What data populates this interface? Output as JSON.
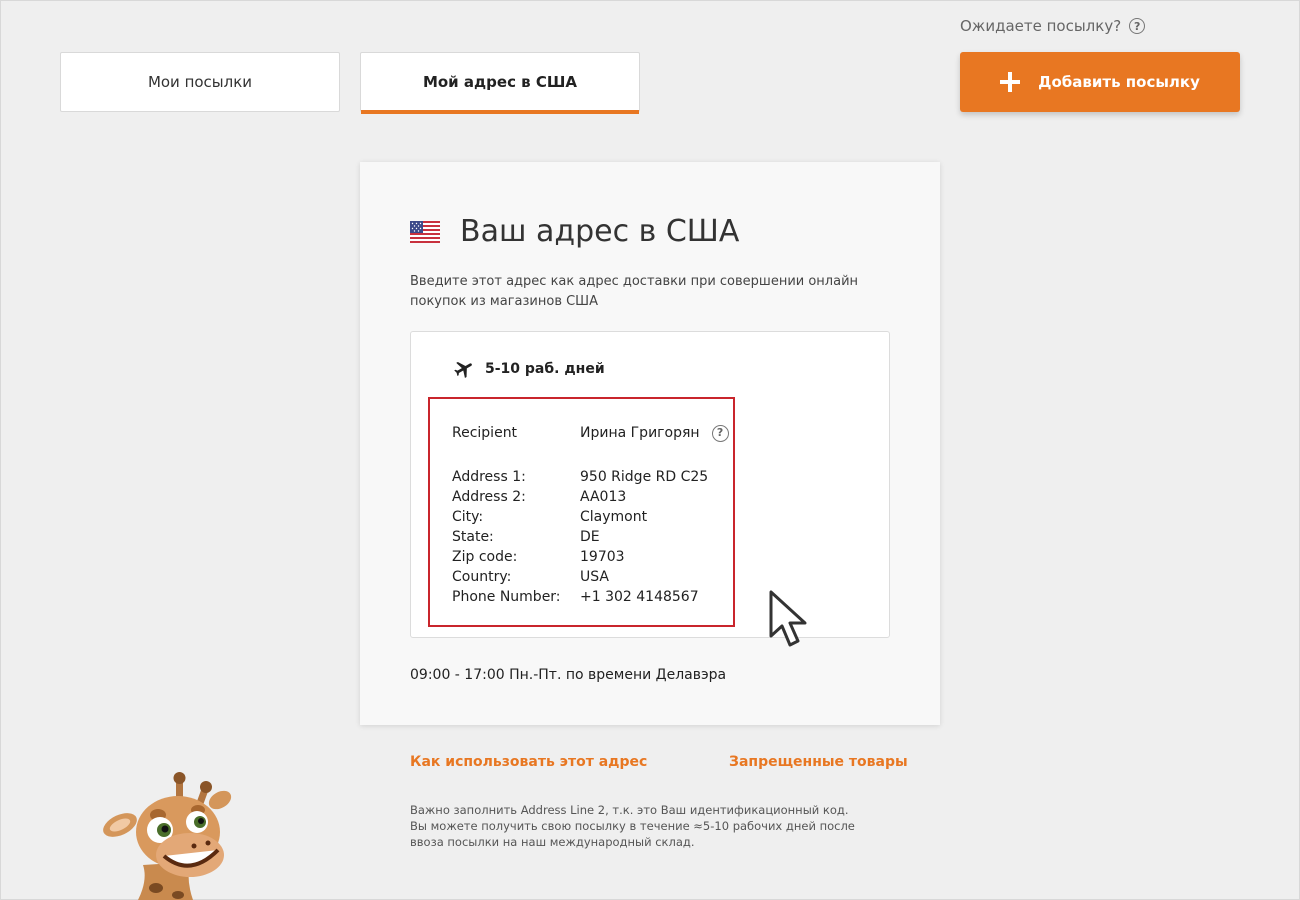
{
  "tabs": [
    {
      "label": "Мои посылки",
      "active": false
    },
    {
      "label": "Мой адрес в США",
      "active": true
    }
  ],
  "header": {
    "waiting_text": "Ожидаете посылку?",
    "help_symbol": "?",
    "add_button_label": "Добавить посылку"
  },
  "card": {
    "flag_icon": "us-flag-icon",
    "title": "Ваш адрес в США",
    "description": "Введите этот адрес как адрес доставки при совершении онлайн покупок из магазинов США",
    "delivery_time": "5-10 раб. дней",
    "recipient": {
      "label": "Recipient",
      "value": "Ирина Григорян"
    },
    "address_fields": [
      {
        "label": "Address 1:",
        "value": "950 Ridge RD C25"
      },
      {
        "label": "Address 2:",
        "value": "AA013"
      },
      {
        "label": "City:",
        "value": "Claymont"
      },
      {
        "label": "State:",
        "value": "DE"
      },
      {
        "label": "Zip code:",
        "value": "19703"
      },
      {
        "label": "Country:",
        "value": "USA"
      },
      {
        "label": "Phone Number:",
        "value": "+1 302 4148567"
      }
    ],
    "hours": "09:00 - 17:00 Пн.-Пт. по времени Делавэра"
  },
  "links": {
    "how_to_use": "Как использовать этот адрес",
    "forbidden_goods": "Запрещенные товары"
  },
  "note": {
    "line1": "Важно заполнить Address Line 2, т.к. это Ваш идентификационный код.",
    "line2": "Вы можете получить свою посылку в течение ≈5-10 рабочих дней после ввоза посылки на наш международный склад."
  },
  "colors": {
    "accent": "#e87722",
    "highlight_border": "#c9252c",
    "background": "#efefef"
  }
}
